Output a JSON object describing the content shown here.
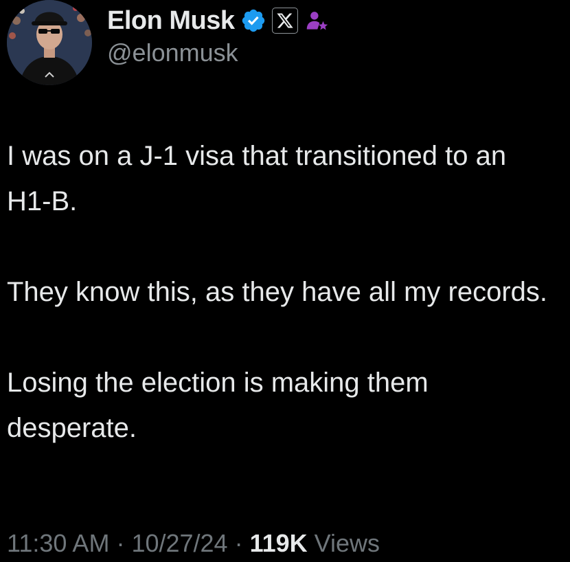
{
  "tweet": {
    "author": {
      "display_name": "Elon Musk",
      "handle": "@elonmusk",
      "verified_badge_icon": "verified-check-icon",
      "affiliation_icon": "x-logo-icon",
      "subscription_icon": "affiliate-person-icon",
      "avatar_icon": "profile-photo"
    },
    "paragraphs": [
      "I was on a J-1 visa that transitioned to an H1-B.",
      "They know this, as they have all my records.",
      "Losing the election is making them desperate."
    ],
    "meta": {
      "time": "11:30 AM",
      "separator": " · ",
      "date": "10/27/24",
      "views_count": "119K",
      "views_label": " Views"
    }
  },
  "colors": {
    "background": "#000000",
    "text_primary": "#e7e9ea",
    "text_secondary": "#8b9196",
    "verified_blue": "#1d9bf0",
    "affiliate_purple": "#9b3fc4"
  }
}
